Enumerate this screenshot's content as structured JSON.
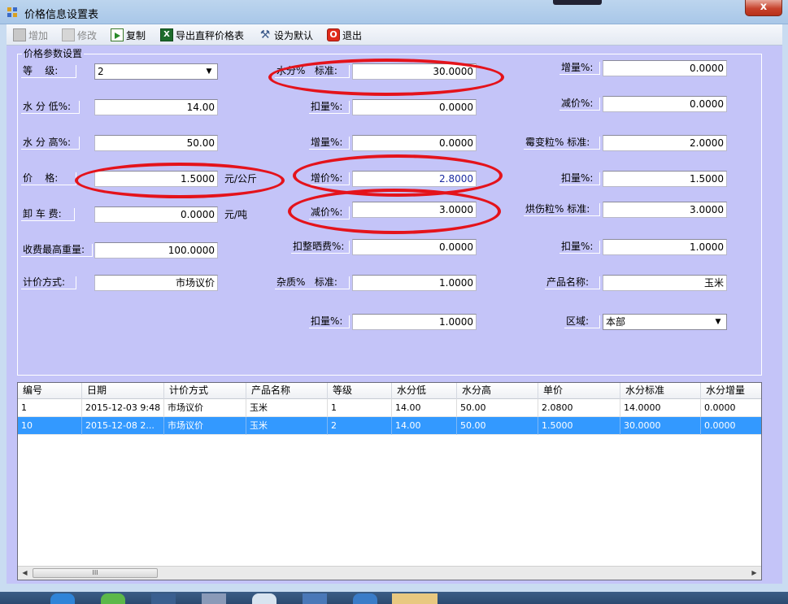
{
  "window": {
    "title": "价格信息设置表",
    "close_glyph": "x"
  },
  "toolbar": {
    "add": "增加",
    "edit": "修改",
    "copy": "复制",
    "export": "导出直秤价格表",
    "set_default": "设为默认",
    "exit": "退出",
    "export_icon_text": "X",
    "exit_icon_text": "O"
  },
  "group": {
    "title": "价格参数设置"
  },
  "col1": {
    "grade_label": "等    级:",
    "grade_value": "2",
    "moisture_low_label": "水 分 低%:",
    "moisture_low_value": "14.00",
    "moisture_high_label": "水 分 高%:",
    "moisture_high_value": "50.00",
    "price_label": "价    格:",
    "price_value": "1.5000",
    "price_unit": "元/公斤",
    "unload_fee_label": "卸 车 费:",
    "unload_fee_value": "0.0000",
    "unload_fee_unit": "元/吨",
    "max_weight_label": "收费最高重量:",
    "max_weight_value": "100.0000",
    "pricing_method_label": "计价方式:",
    "pricing_method_value": "市场议价"
  },
  "col2": {
    "moisture_std_label": "水分%   标准:",
    "moisture_std_value": "30.0000",
    "deduct1_label": "扣量%:",
    "deduct1_value": "0.0000",
    "increase1_label": "增量%:",
    "increase1_value": "0.0000",
    "add_price_label": "增价%:",
    "add_price_value": "2.8000",
    "reduce_price_label": "减价%:",
    "reduce_price_value": "3.0000",
    "drying_fee_label": "扣整晒费%:",
    "drying_fee_value": "0.0000",
    "impurity_std_label": "杂质%   标准:",
    "impurity_std_value": "1.0000",
    "deduct2_label": "扣量%:",
    "deduct2_value": "1.0000"
  },
  "col3": {
    "increase_label": "增量%:",
    "increase_value": "0.0000",
    "reduce_label": "减价%:",
    "reduce_value": "0.0000",
    "mildew_std_label": "霉变粒% 标准:",
    "mildew_std_value": "2.0000",
    "deduct1_label": "扣量%:",
    "deduct1_value": "1.5000",
    "baked_std_label": "烘伤粒% 标准:",
    "baked_std_value": "3.0000",
    "deduct2_label": "扣量%:",
    "deduct2_value": "1.0000",
    "product_label": "产品名称:",
    "product_value": "玉米",
    "region_label": "区域:",
    "region_value": "本部"
  },
  "grid": {
    "columns": [
      "编号",
      "日期",
      "计价方式",
      "产品名称",
      "等级",
      "水分低",
      "水分高",
      "单价",
      "水分标准",
      "水分增量"
    ],
    "rows": [
      {
        "cells": [
          "1",
          "2015-12-03 9:48",
          "市场议价",
          "玉米",
          "1",
          "14.00",
          "50.00",
          "2.0800",
          "14.0000",
          "0.0000"
        ],
        "selected": false
      },
      {
        "cells": [
          "10",
          "2015-12-08 2...",
          "市场议价",
          "玉米",
          "2",
          "14.00",
          "50.00",
          "1.5000",
          "30.0000",
          "0.0000"
        ],
        "selected": true
      }
    ],
    "scroll_thumb_grip": "III"
  },
  "colors": {
    "highlight_ring": "#e4131b",
    "form_bg": "#c4c4f8",
    "selection": "#3399ff"
  }
}
